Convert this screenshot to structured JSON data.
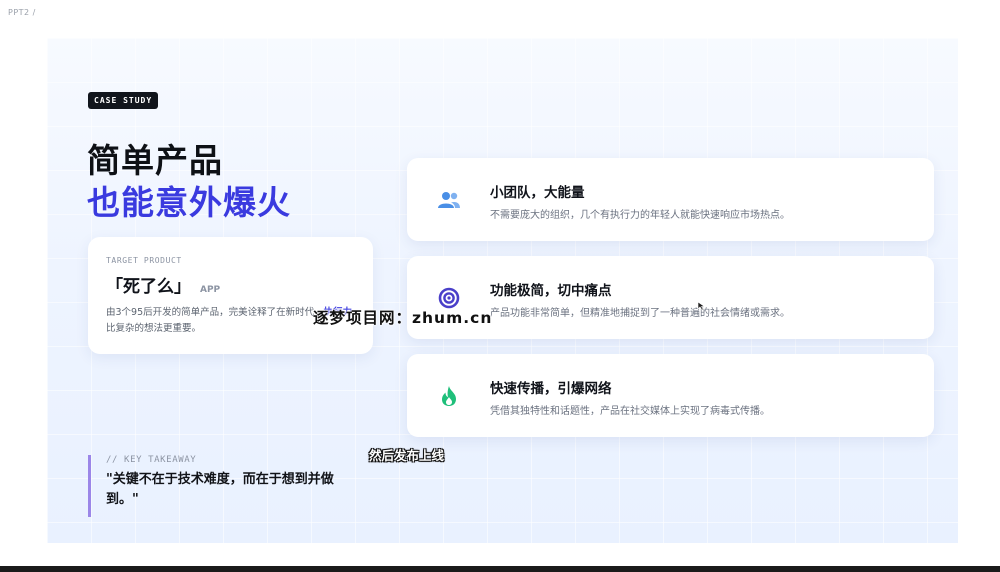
{
  "window": {
    "title": "PPT2 /"
  },
  "slide": {
    "logo_text": "",
    "badge": "CASE STUDY",
    "title_line1": "简单产品",
    "title_line2": "也能意外爆火",
    "accent_color": "#3a3adf",
    "product_card": {
      "label": "TARGET PRODUCT",
      "name": "「死了么」",
      "tag": "APP",
      "desc_before": "由3个95后开发的简单产品，完美诠释了在新时代，",
      "desc_highlight": "执行力",
      "desc_after": "比复杂的想法更重要。"
    },
    "features": [
      {
        "icon": "team-icon",
        "icon_color": "#4a8fe6",
        "title": "小团队，大能量",
        "desc": "不需要庞大的组织，几个有执行力的年轻人就能快速响应市场热点。"
      },
      {
        "icon": "target-icon",
        "icon_color": "#4a3fc9",
        "title": "功能极简，切中痛点",
        "desc": "产品功能非常简单，但精准地捕捉到了一种普遍的社会情绪或需求。"
      },
      {
        "icon": "flame-icon",
        "icon_color": "#1fbf7a",
        "title": "快速传播，引爆网络",
        "desc": "凭借其独特性和话题性，产品在社交媒体上实现了病毒式传播。"
      }
    ],
    "takeaway": {
      "label": "// KEY TAKEAWAY",
      "quote": "\"关键不在于技术难度，而在于想到并做到。\""
    }
  },
  "overlay": {
    "watermark": "逐梦项目网：zhum.cn",
    "subtitle": "然后发布上线"
  }
}
